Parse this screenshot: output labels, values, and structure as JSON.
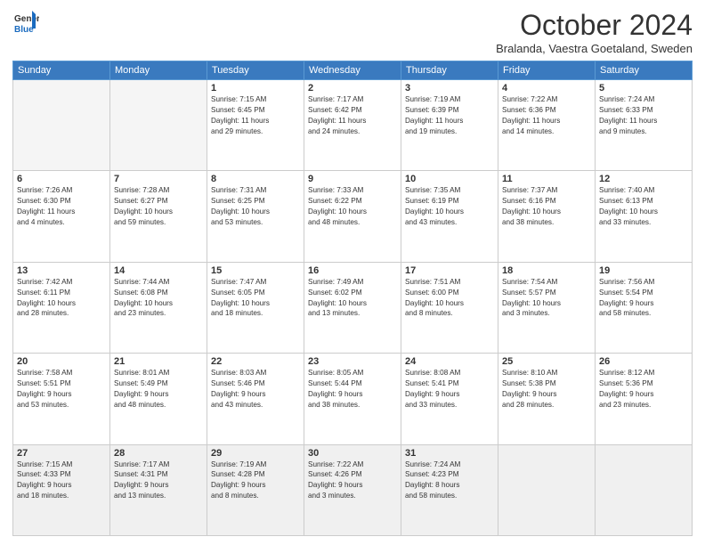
{
  "header": {
    "logo_line1": "General",
    "logo_line2": "Blue",
    "month": "October 2024",
    "location": "Bralanda, Vaestra Goetaland, Sweden"
  },
  "days_of_week": [
    "Sunday",
    "Monday",
    "Tuesday",
    "Wednesday",
    "Thursday",
    "Friday",
    "Saturday"
  ],
  "weeks": [
    [
      {
        "day": "",
        "info": ""
      },
      {
        "day": "",
        "info": ""
      },
      {
        "day": "1",
        "info": "Sunrise: 7:15 AM\nSunset: 6:45 PM\nDaylight: 11 hours\nand 29 minutes."
      },
      {
        "day": "2",
        "info": "Sunrise: 7:17 AM\nSunset: 6:42 PM\nDaylight: 11 hours\nand 24 minutes."
      },
      {
        "day": "3",
        "info": "Sunrise: 7:19 AM\nSunset: 6:39 PM\nDaylight: 11 hours\nand 19 minutes."
      },
      {
        "day": "4",
        "info": "Sunrise: 7:22 AM\nSunset: 6:36 PM\nDaylight: 11 hours\nand 14 minutes."
      },
      {
        "day": "5",
        "info": "Sunrise: 7:24 AM\nSunset: 6:33 PM\nDaylight: 11 hours\nand 9 minutes."
      }
    ],
    [
      {
        "day": "6",
        "info": "Sunrise: 7:26 AM\nSunset: 6:30 PM\nDaylight: 11 hours\nand 4 minutes."
      },
      {
        "day": "7",
        "info": "Sunrise: 7:28 AM\nSunset: 6:27 PM\nDaylight: 10 hours\nand 59 minutes."
      },
      {
        "day": "8",
        "info": "Sunrise: 7:31 AM\nSunset: 6:25 PM\nDaylight: 10 hours\nand 53 minutes."
      },
      {
        "day": "9",
        "info": "Sunrise: 7:33 AM\nSunset: 6:22 PM\nDaylight: 10 hours\nand 48 minutes."
      },
      {
        "day": "10",
        "info": "Sunrise: 7:35 AM\nSunset: 6:19 PM\nDaylight: 10 hours\nand 43 minutes."
      },
      {
        "day": "11",
        "info": "Sunrise: 7:37 AM\nSunset: 6:16 PM\nDaylight: 10 hours\nand 38 minutes."
      },
      {
        "day": "12",
        "info": "Sunrise: 7:40 AM\nSunset: 6:13 PM\nDaylight: 10 hours\nand 33 minutes."
      }
    ],
    [
      {
        "day": "13",
        "info": "Sunrise: 7:42 AM\nSunset: 6:11 PM\nDaylight: 10 hours\nand 28 minutes."
      },
      {
        "day": "14",
        "info": "Sunrise: 7:44 AM\nSunset: 6:08 PM\nDaylight: 10 hours\nand 23 minutes."
      },
      {
        "day": "15",
        "info": "Sunrise: 7:47 AM\nSunset: 6:05 PM\nDaylight: 10 hours\nand 18 minutes."
      },
      {
        "day": "16",
        "info": "Sunrise: 7:49 AM\nSunset: 6:02 PM\nDaylight: 10 hours\nand 13 minutes."
      },
      {
        "day": "17",
        "info": "Sunrise: 7:51 AM\nSunset: 6:00 PM\nDaylight: 10 hours\nand 8 minutes."
      },
      {
        "day": "18",
        "info": "Sunrise: 7:54 AM\nSunset: 5:57 PM\nDaylight: 10 hours\nand 3 minutes."
      },
      {
        "day": "19",
        "info": "Sunrise: 7:56 AM\nSunset: 5:54 PM\nDaylight: 9 hours\nand 58 minutes."
      }
    ],
    [
      {
        "day": "20",
        "info": "Sunrise: 7:58 AM\nSunset: 5:51 PM\nDaylight: 9 hours\nand 53 minutes."
      },
      {
        "day": "21",
        "info": "Sunrise: 8:01 AM\nSunset: 5:49 PM\nDaylight: 9 hours\nand 48 minutes."
      },
      {
        "day": "22",
        "info": "Sunrise: 8:03 AM\nSunset: 5:46 PM\nDaylight: 9 hours\nand 43 minutes."
      },
      {
        "day": "23",
        "info": "Sunrise: 8:05 AM\nSunset: 5:44 PM\nDaylight: 9 hours\nand 38 minutes."
      },
      {
        "day": "24",
        "info": "Sunrise: 8:08 AM\nSunset: 5:41 PM\nDaylight: 9 hours\nand 33 minutes."
      },
      {
        "day": "25",
        "info": "Sunrise: 8:10 AM\nSunset: 5:38 PM\nDaylight: 9 hours\nand 28 minutes."
      },
      {
        "day": "26",
        "info": "Sunrise: 8:12 AM\nSunset: 5:36 PM\nDaylight: 9 hours\nand 23 minutes."
      }
    ],
    [
      {
        "day": "27",
        "info": "Sunrise: 7:15 AM\nSunset: 4:33 PM\nDaylight: 9 hours\nand 18 minutes."
      },
      {
        "day": "28",
        "info": "Sunrise: 7:17 AM\nSunset: 4:31 PM\nDaylight: 9 hours\nand 13 minutes."
      },
      {
        "day": "29",
        "info": "Sunrise: 7:19 AM\nSunset: 4:28 PM\nDaylight: 9 hours\nand 8 minutes."
      },
      {
        "day": "30",
        "info": "Sunrise: 7:22 AM\nSunset: 4:26 PM\nDaylight: 9 hours\nand 3 minutes."
      },
      {
        "day": "31",
        "info": "Sunrise: 7:24 AM\nSunset: 4:23 PM\nDaylight: 8 hours\nand 58 minutes."
      },
      {
        "day": "",
        "info": ""
      },
      {
        "day": "",
        "info": ""
      }
    ]
  ]
}
